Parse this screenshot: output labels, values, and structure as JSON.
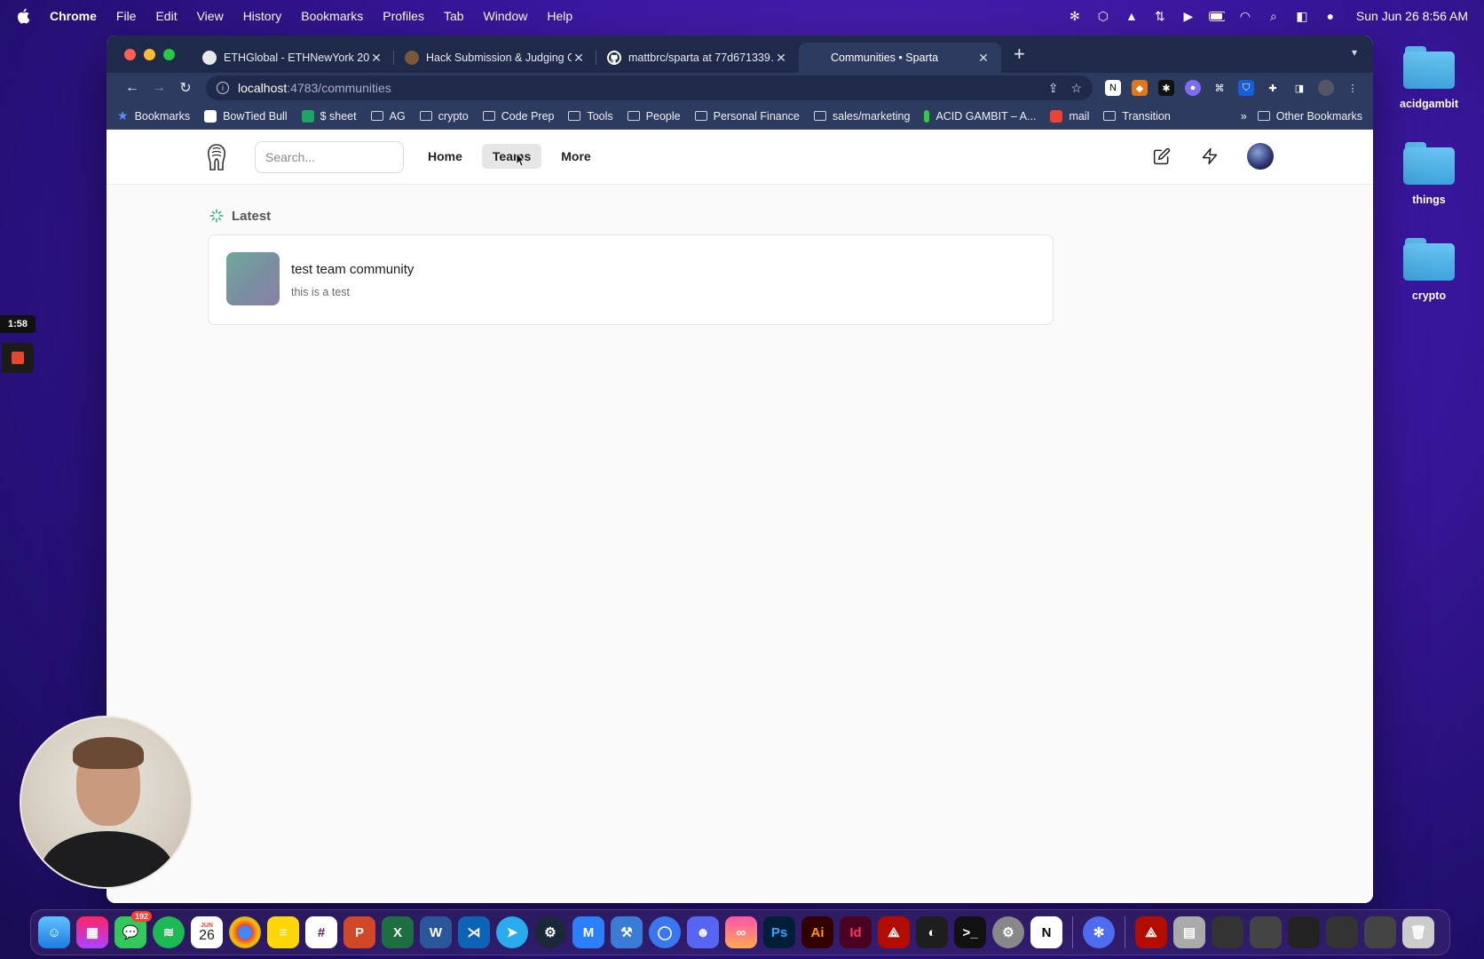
{
  "menubar": {
    "app_name": "Chrome",
    "items": [
      "File",
      "Edit",
      "View",
      "History",
      "Bookmarks",
      "Profiles",
      "Tab",
      "Window",
      "Help"
    ],
    "datetime": "Sun Jun 26  8:56 AM"
  },
  "browser": {
    "tabs": [
      {
        "label": "ETHGlobal - ETHNewYork 202…",
        "favicon_color": "#e8e8e8"
      },
      {
        "label": "Hack Submission & Judging G…",
        "favicon_color": "#7a5a3a"
      },
      {
        "label": "mattbrc/sparta at 77d671339…",
        "favicon_color": "#ffffff"
      },
      {
        "label": "Communities • Sparta",
        "favicon_color": "#333333",
        "active": true
      }
    ],
    "address": {
      "host": "localhost",
      "path": ":4783/communities"
    },
    "bookmarks": [
      {
        "label": "Bookmarks",
        "icon": "star-icon"
      },
      {
        "label": "BowTied Bull",
        "icon": "bull-favicon"
      },
      {
        "label": "$ sheet",
        "icon": "sheets-favicon"
      },
      {
        "label": "AG",
        "icon": "folder-icon"
      },
      {
        "label": "crypto",
        "icon": "folder-icon"
      },
      {
        "label": "Code Prep",
        "icon": "folder-icon"
      },
      {
        "label": "Tools",
        "icon": "folder-icon"
      },
      {
        "label": "People",
        "icon": "folder-icon"
      },
      {
        "label": "Personal Finance",
        "icon": "folder-icon"
      },
      {
        "label": "sales/marketing",
        "icon": "folder-icon"
      },
      {
        "label": "ACID GAMBIT – A...",
        "icon": "acid-favicon"
      },
      {
        "label": "mail",
        "icon": "gmail-favicon"
      },
      {
        "label": "Transition",
        "icon": "folder-icon"
      }
    ],
    "bookmarks_more": "»",
    "other_bookmarks": "Other Bookmarks"
  },
  "site": {
    "search_placeholder": "Search...",
    "nav": [
      {
        "label": "Home",
        "active": false
      },
      {
        "label": "Teams",
        "active": true
      },
      {
        "label": "More",
        "active": false
      }
    ],
    "section_title": "Latest",
    "communities": [
      {
        "title": "test team community",
        "description": "this is a test"
      }
    ]
  },
  "recording": {
    "timer": "1:58"
  },
  "desktop": {
    "folders": [
      "acidgambit",
      "things",
      "crypto"
    ]
  },
  "dock": {
    "messages_badge": "192",
    "calendar_month": "JUN",
    "calendar_day": "26"
  },
  "colors": {
    "accent_green": "#22b07d",
    "active_nav_bg": "#e6e6e6"
  }
}
